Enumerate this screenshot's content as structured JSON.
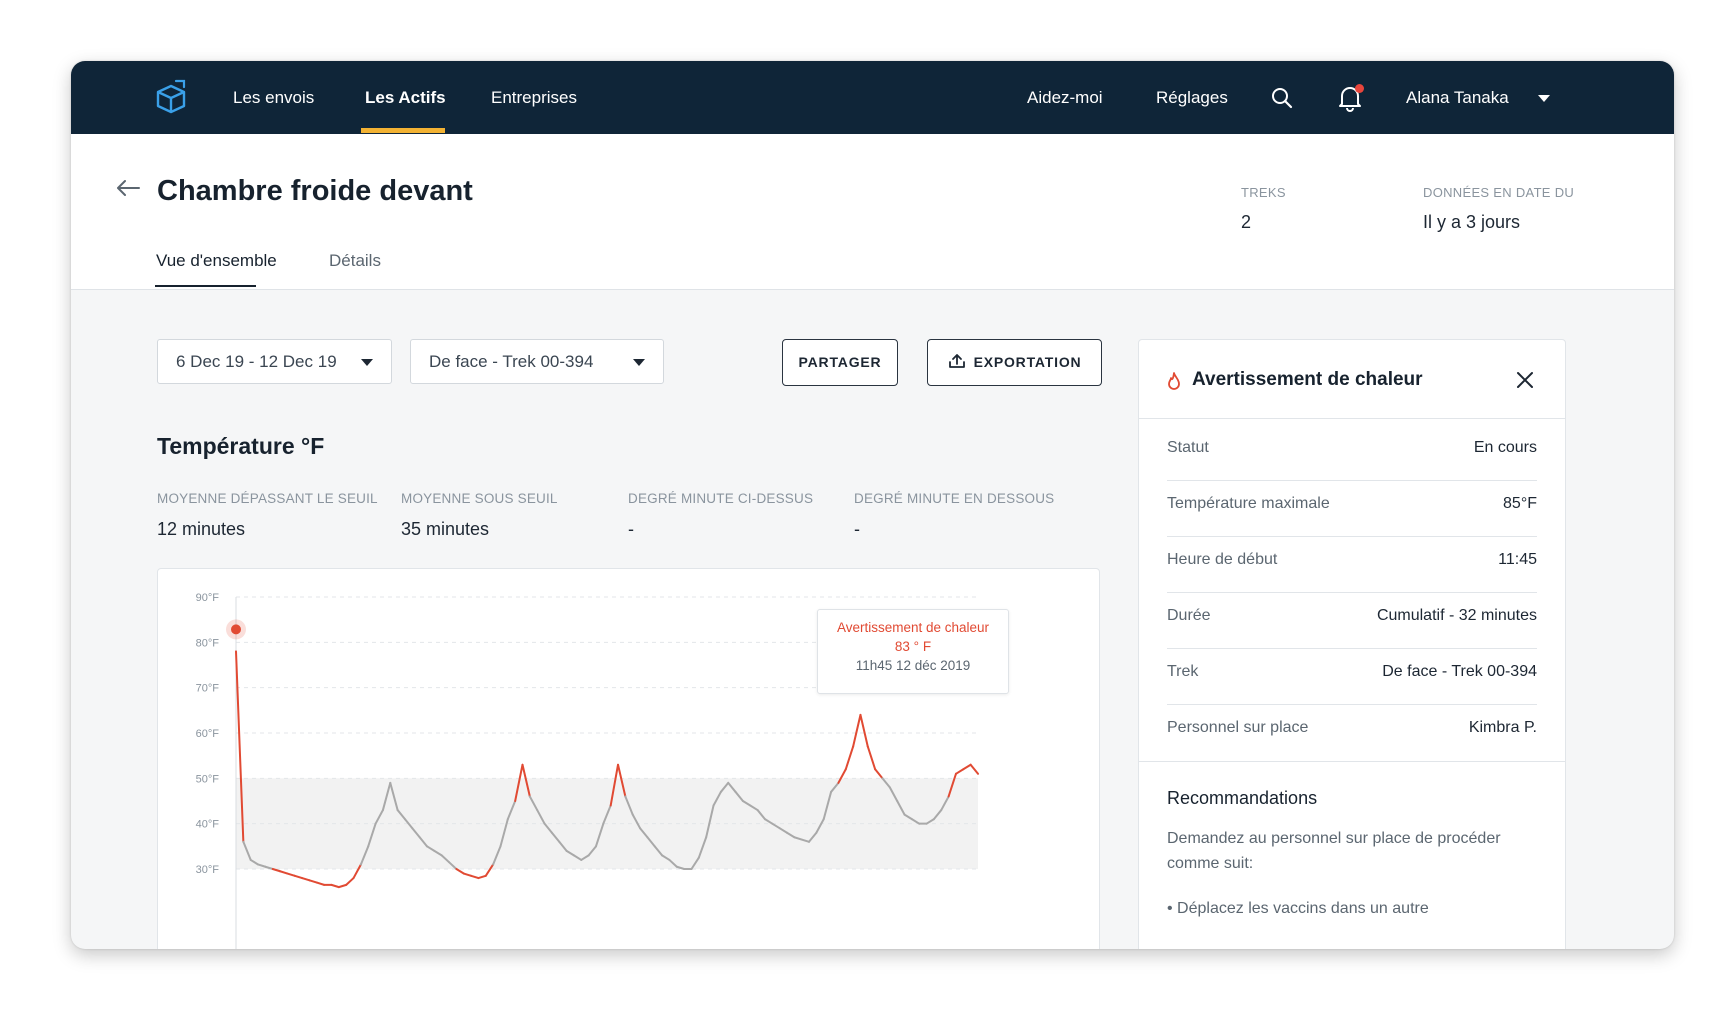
{
  "nav": {
    "items": [
      "Les envois",
      "Les Actifs",
      "Entreprises"
    ],
    "help": "Aidez-moi",
    "settings": "Réglages",
    "user": "Alana Tanaka"
  },
  "page": {
    "title": "Chambre froide devant",
    "tabs": [
      "Vue d'ensemble",
      "Détails"
    ],
    "meta": [
      {
        "label": "TREKS",
        "value": "2"
      },
      {
        "label": "DONNÉES EN DATE DU",
        "value": "Il y a 3 jours"
      }
    ]
  },
  "toolbar": {
    "date_range": "6 Dec 19 - 12 Dec 19",
    "trek": "De face - Trek 00-394",
    "share_label": "PARTAGER",
    "export_label": "EXPORTATION"
  },
  "temperature": {
    "title": "Température °F",
    "stats": [
      {
        "label": "MOYENNE DÉPASSANT LE SEUIL",
        "value": "12 minutes"
      },
      {
        "label": "MOYENNE SOUS SEUIL",
        "value": "35 minutes"
      },
      {
        "label": "DEGRÉ MINUTE CI-DESSUS",
        "value": "-"
      },
      {
        "label": "DEGRÉ MINUTE EN DESSOUS",
        "value": "-"
      }
    ]
  },
  "chart_data": {
    "type": "line",
    "title": "",
    "xlabel": "",
    "ylabel": "",
    "y_ticks": [
      "90°F",
      "80°F",
      "70°F",
      "60°F",
      "50°F",
      "40°F",
      "30°F"
    ],
    "ylim": [
      20,
      90
    ],
    "threshold_band": [
      30,
      50
    ],
    "grid": true,
    "colors": {
      "in_range": "#a9a9a9",
      "out_of_range": "#e14a33",
      "band": "#f2f2f2"
    },
    "series": [
      {
        "values": [
          78,
          36,
          32,
          31,
          30.5,
          30,
          29.5,
          29,
          28.5,
          28,
          27.5,
          27,
          26.5,
          26.5,
          26,
          26.5,
          28,
          31,
          35,
          40,
          43,
          49,
          43,
          41,
          39,
          37,
          35,
          34,
          33,
          31.5,
          30,
          29,
          28.5,
          28,
          28.5,
          31,
          35,
          41,
          45,
          53,
          46,
          43,
          40,
          38,
          36,
          34,
          33,
          32,
          33,
          35,
          40,
          44,
          53,
          46,
          42,
          39,
          37,
          35,
          33,
          32,
          30.5,
          30,
          30,
          32.5,
          37,
          44,
          47,
          49,
          47,
          45,
          44,
          43,
          41,
          40,
          39,
          38,
          37,
          36.5,
          36,
          38,
          41,
          47,
          49,
          52,
          57,
          64,
          57,
          52,
          50,
          48,
          45,
          42,
          41,
          40,
          40,
          41,
          43,
          46,
          51,
          52,
          53,
          51
        ]
      }
    ],
    "tooltip": {
      "title": "Avertissement de chaleur",
      "value": "83 ° F",
      "time": "11h45 12 déc 2019"
    }
  },
  "alert_panel": {
    "title": "Avertissement de chaleur",
    "rows": [
      {
        "label": "Statut",
        "value": "En cours"
      },
      {
        "label": "Température maximale",
        "value": "85°F"
      },
      {
        "label": "Heure de début",
        "value": "11:45"
      },
      {
        "label": "Durée",
        "value": "Cumulatif - 32 minutes"
      },
      {
        "label": "Trek",
        "value": "De face - Trek 00-394"
      },
      {
        "label": "Personnel sur place",
        "value": "Kimbra P."
      }
    ],
    "recommendations_title": "Recommandations",
    "recommendations_text": "Demandez au personnel sur place de procéder comme suit:",
    "recommendations_bullet": "• Déplacez les vaccins dans un autre"
  },
  "colors": {
    "nav_bg": "#0f2538",
    "accent": "#f2b233",
    "alert": "#e14a33",
    "logo": "#3aa0e8"
  }
}
